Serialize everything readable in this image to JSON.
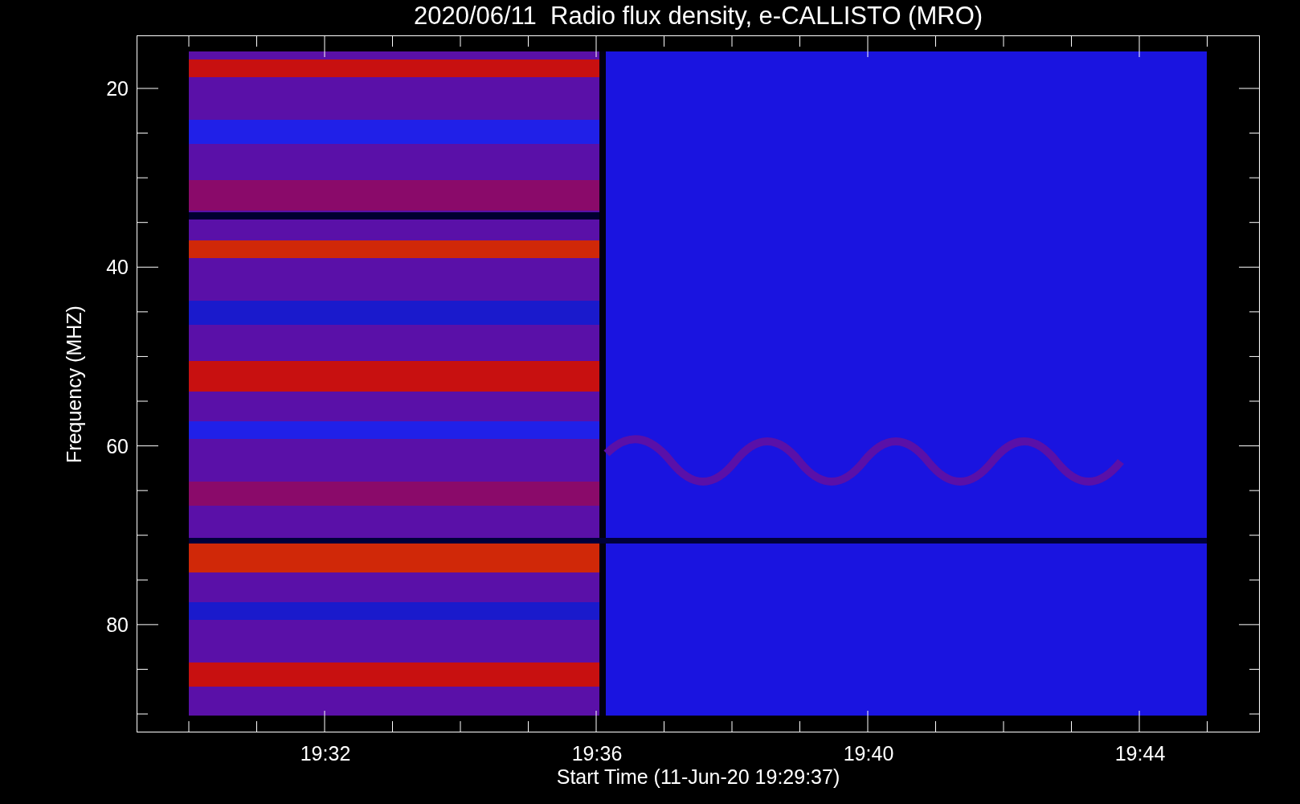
{
  "plot": {
    "title": "2020/06/11  Radio flux density, e-CALLISTO (MRO)",
    "y_axis": {
      "label": "Frequency (MHZ)",
      "ticks": [
        "20",
        "40",
        "60",
        "80"
      ]
    },
    "x_axis": {
      "label": "Start Time (11-Jun-20 19:29:37)",
      "ticks": [
        "19:32",
        "19:36",
        "19:40",
        "19:44"
      ]
    }
  }
}
